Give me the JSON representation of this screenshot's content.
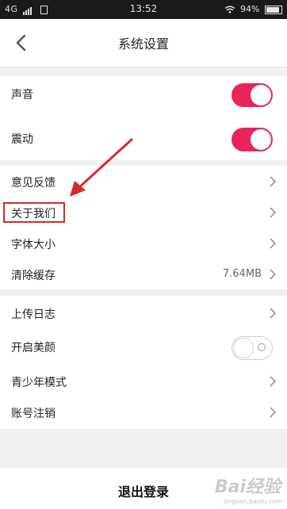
{
  "status_bar": {
    "network": "4G",
    "sim_icon": "sim-icon",
    "time": "13:52",
    "wifi_icon": "wifi-icon",
    "battery": "94%"
  },
  "header": {
    "back_icon": "chevron-left-icon",
    "title": "系统设置"
  },
  "sections": {
    "toggles": [
      {
        "label": "声音",
        "state": "on"
      },
      {
        "label": "震动",
        "state": "on"
      }
    ],
    "info": [
      {
        "label": "意见反馈"
      },
      {
        "label": "关于我们"
      },
      {
        "label": "字体大小"
      },
      {
        "label": "清除缓存",
        "value": "7.64MB"
      }
    ],
    "more": [
      {
        "label": "上传日志"
      },
      {
        "label": "开启美颜",
        "state": "off"
      },
      {
        "label": "青少年模式"
      },
      {
        "label": "账号注销"
      }
    ]
  },
  "logout": {
    "label": "退出登录"
  },
  "colors": {
    "accent": "#e8245a",
    "highlight": "#d42a2a",
    "background": "#f0f0f0"
  },
  "watermark": {
    "text": "Bai经验",
    "sub": "jingyan.baidu.com"
  }
}
